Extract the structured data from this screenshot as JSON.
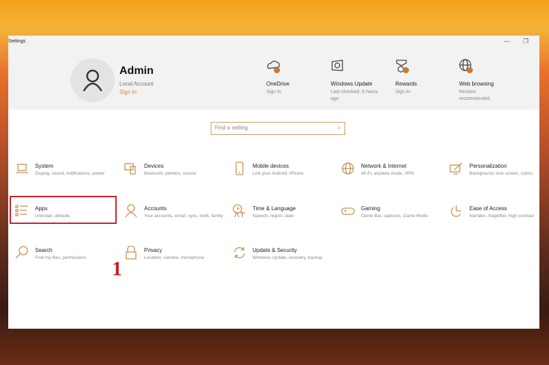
{
  "window": {
    "title": "Settings",
    "minimize": "—",
    "restore": "❐"
  },
  "user": {
    "name": "Admin",
    "account": "Local Account",
    "sign_in": "Sign In"
  },
  "quick": [
    {
      "title": "OneDrive",
      "sub": "Sign In",
      "icon": "cloud-icon"
    },
    {
      "title": "Windows Update",
      "sub": "Last checked: 6 hours ago",
      "icon": "update-icon"
    },
    {
      "title": "Rewards",
      "sub": "Sign In",
      "icon": "rewards-icon"
    },
    {
      "title": "Web browsing",
      "sub": "Restore recommended",
      "icon": "globe-icon"
    }
  ],
  "search": {
    "placeholder": "Find a setting",
    "icon": "search-icon"
  },
  "items": [
    {
      "title": "System",
      "sub": "Display, sound, notifications, power",
      "icon": "laptop-icon"
    },
    {
      "title": "Devices",
      "sub": "Bluetooth, printers, mouse",
      "icon": "devices-icon"
    },
    {
      "title": "Mobile devices",
      "sub": "Link your Android, iPhone",
      "icon": "phone-icon"
    },
    {
      "title": "Network & Internet",
      "sub": "Wi-Fi, airplane mode, VPN",
      "icon": "globe-icon"
    },
    {
      "title": "Personalization",
      "sub": "Background, lock screen, colors",
      "icon": "paint-icon"
    },
    {
      "title": "Apps",
      "sub": "Uninstall, defaults",
      "icon": "apps-list-icon"
    },
    {
      "title": "Accounts",
      "sub": "Your accounts, email, sync, work, family",
      "icon": "person-icon"
    },
    {
      "title": "Time & Language",
      "sub": "Speech, region, date",
      "icon": "time-language-icon"
    },
    {
      "title": "Gaming",
      "sub": "Game Bar, captures, Game Mode",
      "icon": "gamepad-icon"
    },
    {
      "title": "Ease of Access",
      "sub": "Narrator, magnifier, high contrast",
      "icon": "ease-access-icon"
    },
    {
      "title": "Search",
      "sub": "Find my files, permissions",
      "icon": "search-icon"
    },
    {
      "title": "Privacy",
      "sub": "Location, camera, microphone",
      "icon": "lock-icon"
    },
    {
      "title": "Update & Security",
      "sub": "Windows Update, recovery, backup",
      "icon": "sync-icon"
    }
  ],
  "annotation": "1",
  "colors": {
    "accent": "#c89050",
    "highlight": "#c8202a"
  }
}
